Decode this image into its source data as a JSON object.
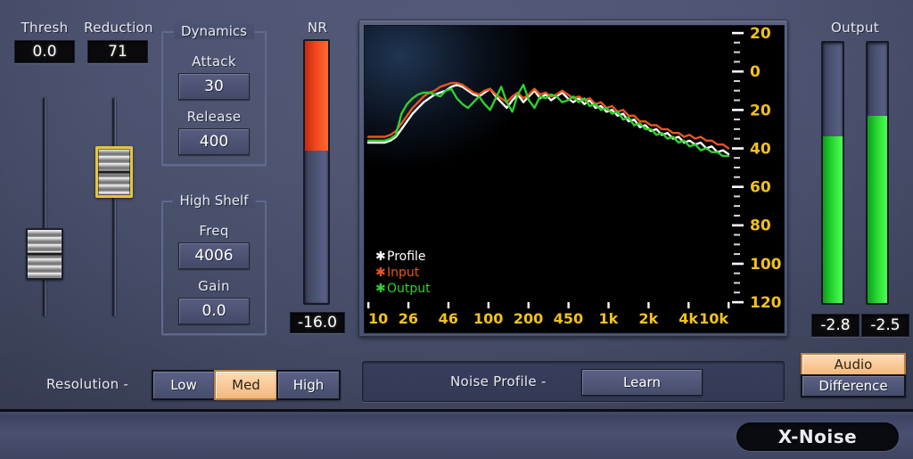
{
  "plugin": {
    "name": "X-Noise"
  },
  "threshold": {
    "label": "Thresh",
    "value": "0.0",
    "slider_pct": 22
  },
  "reduction": {
    "label": "Reduction",
    "value": "71",
    "slider_pct": 71
  },
  "dynamics": {
    "title": "Dynamics",
    "attack": {
      "label": "Attack",
      "value": "30"
    },
    "release": {
      "label": "Release",
      "value": "400"
    }
  },
  "high_shelf": {
    "title": "High Shelf",
    "freq": {
      "label": "Freq",
      "value": "4006"
    },
    "gain": {
      "label": "Gain",
      "value": "0.0"
    }
  },
  "nr_meter": {
    "label": "NR",
    "value": "-16.0",
    "fill_pct": 42
  },
  "output": {
    "label": "Output",
    "meters": [
      {
        "value": "-2.8",
        "fill_pct": 64
      },
      {
        "value": "-2.5",
        "fill_pct": 72
      }
    ]
  },
  "resolution": {
    "label": "Resolution -",
    "options": [
      "Low",
      "Med",
      "High"
    ],
    "selected": "Med"
  },
  "noise_profile": {
    "label": "Noise Profile -",
    "button": "Learn"
  },
  "view_mode": {
    "options": [
      "Audio",
      "Difference"
    ],
    "selected": "Audio"
  },
  "chart_data": {
    "type": "line",
    "title": "",
    "xlabel": "",
    "ylabel": "",
    "grid": false,
    "legend_position": "bottom-left",
    "xlim": [
      10,
      10000
    ],
    "ylim": [
      -20,
      120
    ],
    "xticks": [
      "10",
      "26",
      "46",
      "100",
      "200",
      "450",
      "1k",
      "2k",
      "4k",
      "10k"
    ],
    "yticks": [
      "20",
      "0",
      "20",
      "40",
      "60",
      "80",
      "100",
      "120"
    ],
    "axis_color": "#f2c21a",
    "series": [
      {
        "name": "Profile",
        "color": "#ffffff",
        "values": [
          37,
          37,
          37,
          37,
          36,
          34,
          30,
          26,
          22,
          19,
          16,
          14,
          12,
          11,
          10,
          8,
          7,
          8,
          10,
          12,
          13,
          11,
          9,
          13,
          16,
          19,
          15,
          12,
          16,
          13,
          10,
          14,
          12,
          15,
          13,
          11,
          14,
          16,
          14,
          17,
          15,
          19,
          18,
          21,
          20,
          23,
          22,
          26,
          25,
          29,
          28,
          31,
          30,
          33,
          32,
          35,
          34,
          37,
          36,
          38,
          37,
          40,
          39,
          42,
          41,
          43
        ]
      },
      {
        "name": "Input",
        "color": "#e8561e",
        "values": [
          34,
          34,
          34,
          34,
          33,
          31,
          27,
          23,
          19,
          16,
          13,
          11,
          10,
          8,
          7,
          6,
          6,
          7,
          9,
          11,
          12,
          10,
          9,
          12,
          14,
          16,
          13,
          11,
          14,
          12,
          9,
          12,
          11,
          13,
          12,
          10,
          12,
          14,
          13,
          15,
          14,
          17,
          16,
          19,
          18,
          21,
          20,
          23,
          23,
          26,
          26,
          28,
          28,
          30,
          30,
          32,
          32,
          34,
          33,
          35,
          34,
          36,
          36,
          38,
          38,
          40
        ]
      },
      {
        "name": "Output",
        "color": "#2fd12f",
        "values": [
          36,
          36,
          36,
          36,
          35,
          33,
          22,
          17,
          14,
          12,
          11,
          11,
          12,
          13,
          10,
          9,
          14,
          17,
          19,
          16,
          13,
          17,
          20,
          14,
          8,
          16,
          21,
          12,
          7,
          15,
          19,
          13,
          14,
          12,
          13,
          16,
          15,
          13,
          16,
          14,
          18,
          17,
          20,
          19,
          22,
          21,
          25,
          24,
          28,
          27,
          30,
          30,
          33,
          32,
          35,
          34,
          37,
          36,
          39,
          38,
          41,
          40,
          42,
          42,
          44,
          44
        ]
      }
    ]
  }
}
